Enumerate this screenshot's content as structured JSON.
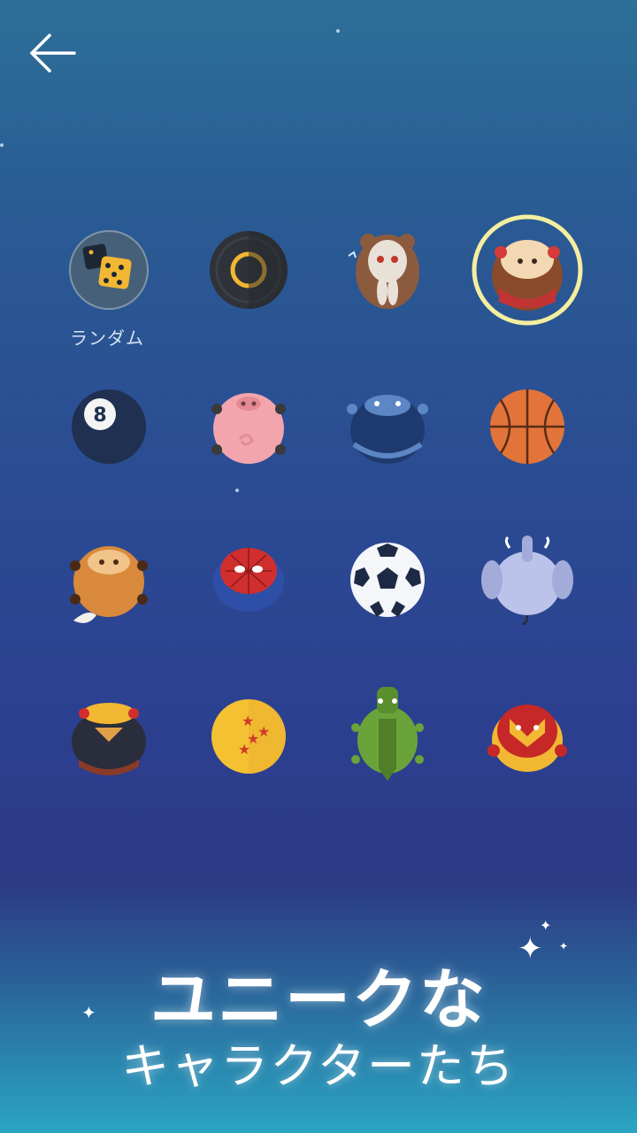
{
  "header": {
    "back_icon": "arrow-left-icon"
  },
  "characters": [
    {
      "name": "random",
      "label": "ランダム"
    },
    {
      "name": "tire"
    },
    {
      "name": "bunny",
      "label": ""
    },
    {
      "name": "lion-selected"
    },
    {
      "name": "eight-ball"
    },
    {
      "name": "pig"
    },
    {
      "name": "blue-beast"
    },
    {
      "name": "basketball"
    },
    {
      "name": "fox"
    },
    {
      "name": "spider-hero"
    },
    {
      "name": "soccer-ball"
    },
    {
      "name": "elephant"
    },
    {
      "name": "warrior"
    },
    {
      "name": "dragon-ball"
    },
    {
      "name": "crocodile"
    },
    {
      "name": "iron-hero"
    }
  ],
  "promo": {
    "line1": "ユニークな",
    "line2": "キャラクターたち"
  },
  "colors": {
    "selection_ring": "#f4eea0",
    "background_top": "#2c6f98",
    "background_bottom": "#2aa5c2"
  }
}
